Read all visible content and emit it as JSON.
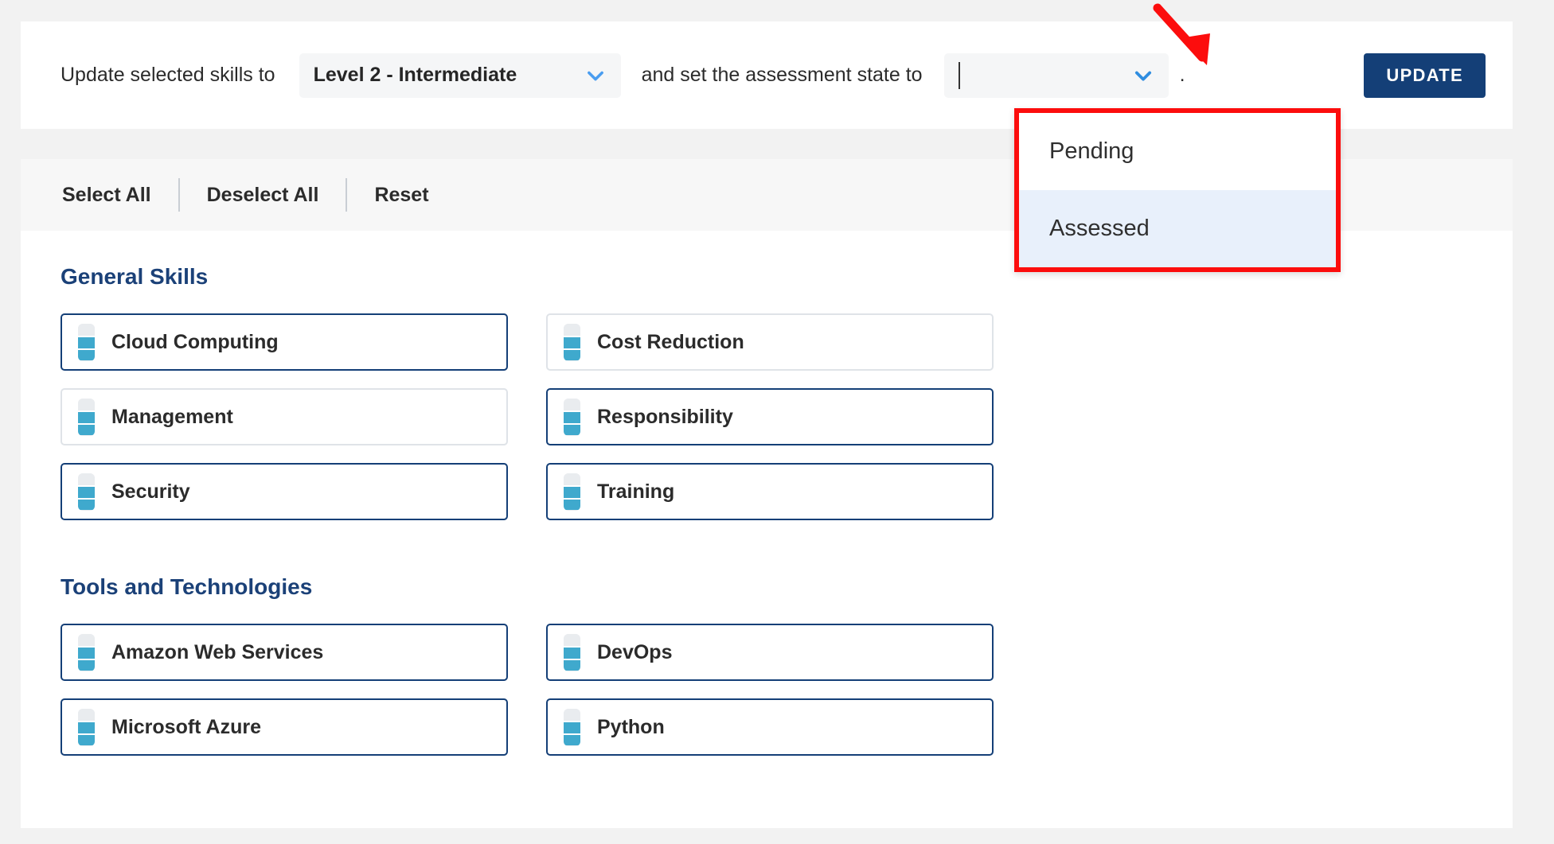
{
  "toolbar": {
    "prefix_label": "Update selected skills to",
    "level_select": {
      "value": "Level 2 - Intermediate",
      "icon": "chevron-down-icon"
    },
    "middle_label": "and set the assessment state to",
    "state_select": {
      "value": "",
      "placeholder": "",
      "icon": "chevron-down-icon"
    },
    "suffix_label": ".",
    "update_label": "UPDATE"
  },
  "dropdown": {
    "options": [
      {
        "label": "Pending",
        "highlighted": false
      },
      {
        "label": "Assessed",
        "highlighted": true
      }
    ]
  },
  "annotation": {
    "arrow_color": "#fc0d0d",
    "highlight_color": "#fc0d0d"
  },
  "action_bar": {
    "select_all": "Select All",
    "deselect_all": "Deselect All",
    "reset": "Reset"
  },
  "colors": {
    "brand_navy": "#143f77",
    "accent_teal": "#3fa9cd",
    "heading_blue": "#1b4178",
    "highlight_row": "#e8f0fb"
  },
  "sections": [
    {
      "title": "General Skills",
      "skills": [
        {
          "name": "Cloud Computing",
          "level": 2,
          "selected": true
        },
        {
          "name": "Cost Reduction",
          "level": 2,
          "selected": false
        },
        {
          "name": "Management",
          "level": 2,
          "selected": false
        },
        {
          "name": "Responsibility",
          "level": 2,
          "selected": true
        },
        {
          "name": "Security",
          "level": 2,
          "selected": true
        },
        {
          "name": "Training",
          "level": 2,
          "selected": true
        }
      ]
    },
    {
      "title": "Tools and Technologies",
      "skills": [
        {
          "name": "Amazon Web Services",
          "level": 2,
          "selected": true
        },
        {
          "name": "DevOps",
          "level": 2,
          "selected": true
        },
        {
          "name": "Microsoft Azure",
          "level": 2,
          "selected": true
        },
        {
          "name": "Python",
          "level": 2,
          "selected": true
        }
      ]
    }
  ]
}
